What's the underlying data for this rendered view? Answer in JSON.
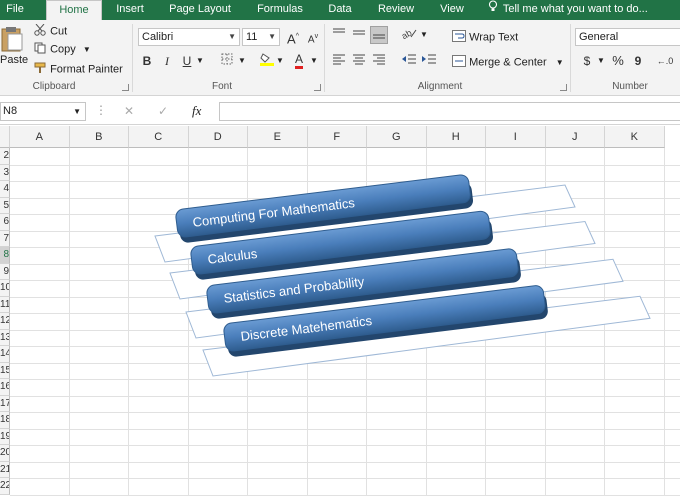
{
  "ribbon": {
    "tabs": [
      {
        "label": "File",
        "active": false
      },
      {
        "label": "Home",
        "active": true
      },
      {
        "label": "Insert",
        "active": false
      },
      {
        "label": "Page Layout",
        "active": false
      },
      {
        "label": "Formulas",
        "active": false
      },
      {
        "label": "Data",
        "active": false
      },
      {
        "label": "Review",
        "active": false
      },
      {
        "label": "View",
        "active": false
      }
    ],
    "tell_me": "Tell me what you want to do...",
    "clipboard": {
      "paste": "Paste",
      "cut": "Cut",
      "copy": "Copy",
      "format_painter": "Format Painter",
      "label": "Clipboard"
    },
    "font": {
      "family": "Calibri",
      "size": "11",
      "label": "Font",
      "bold": "B",
      "italic": "I",
      "underline": "U",
      "grow": "A",
      "shrink": "A",
      "font_color_letter": "A"
    },
    "alignment": {
      "wrap_text": "Wrap Text",
      "merge_center": "Merge & Center",
      "label": "Alignment"
    },
    "number": {
      "format": "General",
      "currency": "$",
      "percent": "%",
      "comma": "9",
      "label": "Number"
    }
  },
  "formula_bar": {
    "name_box": "N8",
    "fx": "fx",
    "cancel": "✕",
    "enter": "✓",
    "value": ""
  },
  "grid": {
    "columns": [
      "A",
      "B",
      "C",
      "D",
      "E",
      "F",
      "G",
      "H",
      "I",
      "J",
      "K"
    ],
    "rows": [
      "2",
      "3",
      "4",
      "5",
      "6",
      "7",
      "8",
      "9",
      "10",
      "11",
      "12",
      "13",
      "14",
      "15",
      "16",
      "17",
      "18",
      "19",
      "20",
      "21",
      "22"
    ],
    "selected_row": "8"
  },
  "smartart": {
    "items": [
      "Computing For Mathematics",
      "Calculus",
      "Statistics and Probability",
      "Discrete Matehematics"
    ],
    "fill_color": "#4a7ebb",
    "edge_color": "#2f5d8f"
  }
}
